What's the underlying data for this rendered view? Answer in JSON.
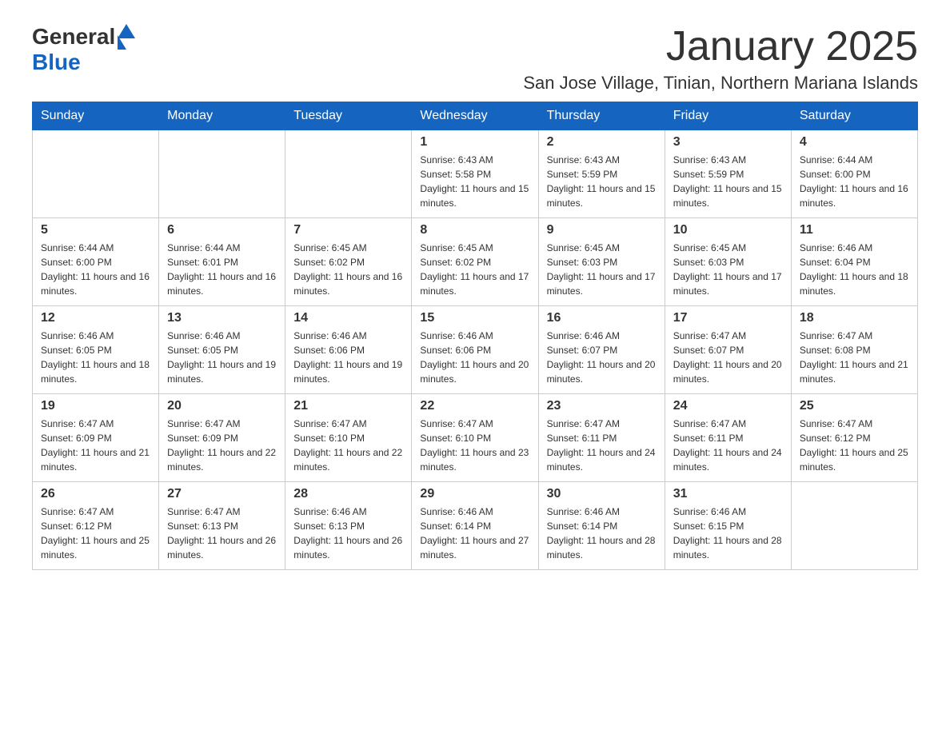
{
  "header": {
    "logo_general": "General",
    "logo_blue": "Blue",
    "month_title": "January 2025",
    "location": "San Jose Village, Tinian, Northern Mariana Islands"
  },
  "days_of_week": [
    "Sunday",
    "Monday",
    "Tuesday",
    "Wednesday",
    "Thursday",
    "Friday",
    "Saturday"
  ],
  "weeks": [
    [
      {
        "day": "",
        "info": ""
      },
      {
        "day": "",
        "info": ""
      },
      {
        "day": "",
        "info": ""
      },
      {
        "day": "1",
        "info": "Sunrise: 6:43 AM\nSunset: 5:58 PM\nDaylight: 11 hours and 15 minutes."
      },
      {
        "day": "2",
        "info": "Sunrise: 6:43 AM\nSunset: 5:59 PM\nDaylight: 11 hours and 15 minutes."
      },
      {
        "day": "3",
        "info": "Sunrise: 6:43 AM\nSunset: 5:59 PM\nDaylight: 11 hours and 15 minutes."
      },
      {
        "day": "4",
        "info": "Sunrise: 6:44 AM\nSunset: 6:00 PM\nDaylight: 11 hours and 16 minutes."
      }
    ],
    [
      {
        "day": "5",
        "info": "Sunrise: 6:44 AM\nSunset: 6:00 PM\nDaylight: 11 hours and 16 minutes."
      },
      {
        "day": "6",
        "info": "Sunrise: 6:44 AM\nSunset: 6:01 PM\nDaylight: 11 hours and 16 minutes."
      },
      {
        "day": "7",
        "info": "Sunrise: 6:45 AM\nSunset: 6:02 PM\nDaylight: 11 hours and 16 minutes."
      },
      {
        "day": "8",
        "info": "Sunrise: 6:45 AM\nSunset: 6:02 PM\nDaylight: 11 hours and 17 minutes."
      },
      {
        "day": "9",
        "info": "Sunrise: 6:45 AM\nSunset: 6:03 PM\nDaylight: 11 hours and 17 minutes."
      },
      {
        "day": "10",
        "info": "Sunrise: 6:45 AM\nSunset: 6:03 PM\nDaylight: 11 hours and 17 minutes."
      },
      {
        "day": "11",
        "info": "Sunrise: 6:46 AM\nSunset: 6:04 PM\nDaylight: 11 hours and 18 minutes."
      }
    ],
    [
      {
        "day": "12",
        "info": "Sunrise: 6:46 AM\nSunset: 6:05 PM\nDaylight: 11 hours and 18 minutes."
      },
      {
        "day": "13",
        "info": "Sunrise: 6:46 AM\nSunset: 6:05 PM\nDaylight: 11 hours and 19 minutes."
      },
      {
        "day": "14",
        "info": "Sunrise: 6:46 AM\nSunset: 6:06 PM\nDaylight: 11 hours and 19 minutes."
      },
      {
        "day": "15",
        "info": "Sunrise: 6:46 AM\nSunset: 6:06 PM\nDaylight: 11 hours and 20 minutes."
      },
      {
        "day": "16",
        "info": "Sunrise: 6:46 AM\nSunset: 6:07 PM\nDaylight: 11 hours and 20 minutes."
      },
      {
        "day": "17",
        "info": "Sunrise: 6:47 AM\nSunset: 6:07 PM\nDaylight: 11 hours and 20 minutes."
      },
      {
        "day": "18",
        "info": "Sunrise: 6:47 AM\nSunset: 6:08 PM\nDaylight: 11 hours and 21 minutes."
      }
    ],
    [
      {
        "day": "19",
        "info": "Sunrise: 6:47 AM\nSunset: 6:09 PM\nDaylight: 11 hours and 21 minutes."
      },
      {
        "day": "20",
        "info": "Sunrise: 6:47 AM\nSunset: 6:09 PM\nDaylight: 11 hours and 22 minutes."
      },
      {
        "day": "21",
        "info": "Sunrise: 6:47 AM\nSunset: 6:10 PM\nDaylight: 11 hours and 22 minutes."
      },
      {
        "day": "22",
        "info": "Sunrise: 6:47 AM\nSunset: 6:10 PM\nDaylight: 11 hours and 23 minutes."
      },
      {
        "day": "23",
        "info": "Sunrise: 6:47 AM\nSunset: 6:11 PM\nDaylight: 11 hours and 24 minutes."
      },
      {
        "day": "24",
        "info": "Sunrise: 6:47 AM\nSunset: 6:11 PM\nDaylight: 11 hours and 24 minutes."
      },
      {
        "day": "25",
        "info": "Sunrise: 6:47 AM\nSunset: 6:12 PM\nDaylight: 11 hours and 25 minutes."
      }
    ],
    [
      {
        "day": "26",
        "info": "Sunrise: 6:47 AM\nSunset: 6:12 PM\nDaylight: 11 hours and 25 minutes."
      },
      {
        "day": "27",
        "info": "Sunrise: 6:47 AM\nSunset: 6:13 PM\nDaylight: 11 hours and 26 minutes."
      },
      {
        "day": "28",
        "info": "Sunrise: 6:46 AM\nSunset: 6:13 PM\nDaylight: 11 hours and 26 minutes."
      },
      {
        "day": "29",
        "info": "Sunrise: 6:46 AM\nSunset: 6:14 PM\nDaylight: 11 hours and 27 minutes."
      },
      {
        "day": "30",
        "info": "Sunrise: 6:46 AM\nSunset: 6:14 PM\nDaylight: 11 hours and 28 minutes."
      },
      {
        "day": "31",
        "info": "Sunrise: 6:46 AM\nSunset: 6:15 PM\nDaylight: 11 hours and 28 minutes."
      },
      {
        "day": "",
        "info": ""
      }
    ]
  ]
}
